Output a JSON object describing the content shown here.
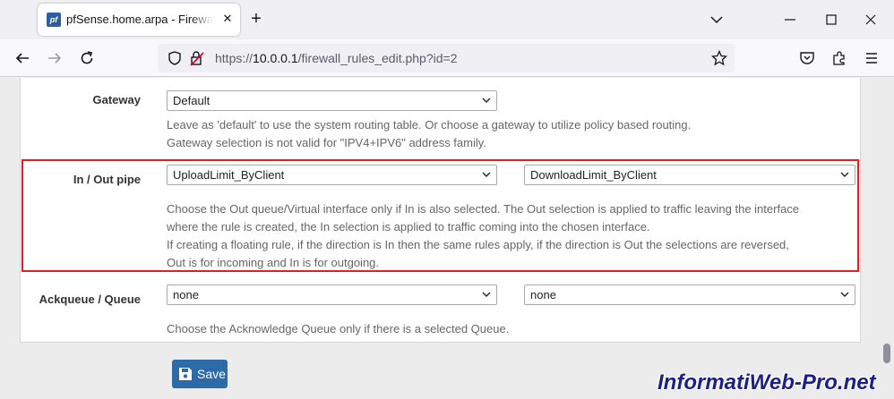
{
  "browser": {
    "tab": {
      "favicon_text": "pf",
      "title": "pfSense.home.arpa - Firewall: Rules"
    },
    "url": {
      "prefix": "https://",
      "host": "10.0.0.1",
      "path": "/firewall_rules_edit.php?id=2"
    }
  },
  "form": {
    "gateway": {
      "label": "Gateway",
      "value": "Default",
      "help_lines": [
        "Leave as 'default' to use the system routing table. Or choose a gateway to utilize policy based routing.",
        "Gateway selection is not valid for \"IPV4+IPV6\" address family."
      ]
    },
    "pipe": {
      "label": "In / Out pipe",
      "in_value": "UploadLimit_ByClient",
      "out_value": "DownloadLimit_ByClient",
      "help_lines": [
        "Choose the Out queue/Virtual interface only if In is also selected. The Out selection is applied to traffic leaving the interface",
        "where the rule is created, the In selection is applied to traffic coming into the chosen interface.",
        "If creating a floating rule, if the direction is In then the same rules apply, if the direction is Out the selections are reversed,",
        "Out is for incoming and In is for outgoing."
      ]
    },
    "queue": {
      "label": "Ackqueue / Queue",
      "ack_value": "none",
      "queue_value": "none",
      "help": "Choose the Acknowledge Queue only if there is a selected Queue."
    },
    "save_label": "Save"
  },
  "watermark": "InformatiWeb-Pro.net",
  "colors": {
    "highlight": "#e02020",
    "save_button": "#2c6aa8",
    "watermark": "#1b1f8a"
  }
}
